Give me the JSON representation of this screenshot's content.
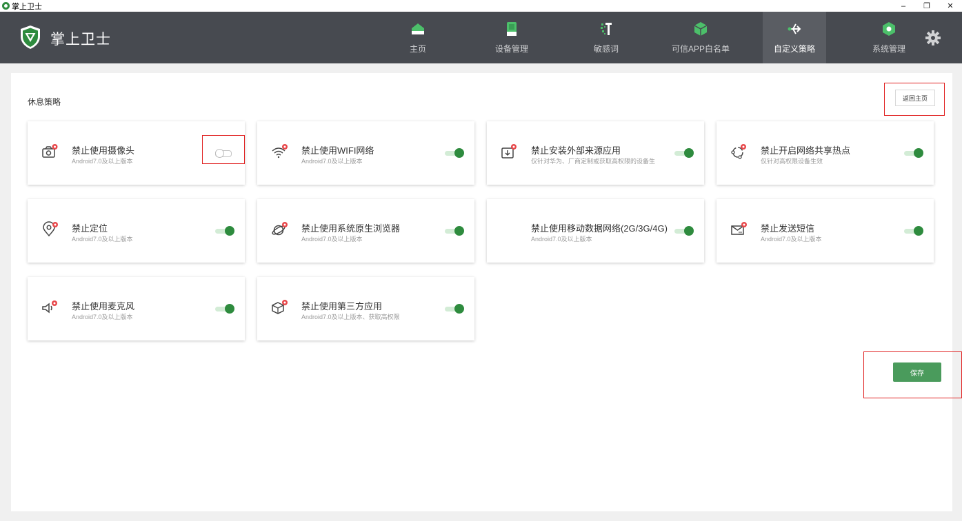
{
  "window": {
    "title": "掌上卫士",
    "buttons": [
      "–",
      "❐",
      "✕"
    ]
  },
  "header": {
    "brand": "掌上卫士",
    "nav": [
      {
        "label": "主页",
        "icon": "home-icon"
      },
      {
        "label": "设备管理",
        "icon": "device-icon"
      },
      {
        "label": "敏感词",
        "icon": "sensitive-word-icon"
      },
      {
        "label": "可信APP白名单",
        "icon": "cube-icon"
      },
      {
        "label": "自定义策略",
        "icon": "share-arrow-icon",
        "active": true
      },
      {
        "label": "系统管理",
        "icon": "settings-hex-icon"
      }
    ],
    "settings_icon": "gear-icon"
  },
  "main": {
    "section_title": "休息策略",
    "back_button": "返回主页",
    "save_button": "保存",
    "cards": [
      {
        "title": "禁止使用摄像头",
        "subtitle": "Android7.0及以上版本",
        "icon": "camera-icon",
        "enabled": false
      },
      {
        "title": "禁止使用WIFI网络",
        "subtitle": "Android7.0及以上版本",
        "icon": "wifi-icon",
        "enabled": true
      },
      {
        "title": "禁止安装外部来源应用",
        "subtitle": "仅针对华为、厂商定制或获取高权限的设备生",
        "icon": "install-icon",
        "enabled": true
      },
      {
        "title": "禁止开启网络共享热点",
        "subtitle": "仅针对高权限设备生效",
        "icon": "hotspot-icon",
        "enabled": true
      },
      {
        "title": "禁止定位",
        "subtitle": "Android7.0及以上版本",
        "icon": "location-icon",
        "enabled": true
      },
      {
        "title": "禁止使用系统原生浏览器",
        "subtitle": "Android7.0及以上版本",
        "icon": "browser-icon",
        "enabled": true
      },
      {
        "title": "禁止使用移动数据网络(2G/3G/4G)",
        "subtitle": "Android7.0及以上版本",
        "icon": "",
        "enabled": true
      },
      {
        "title": "禁止发送短信",
        "subtitle": "Android7.0及以上版本",
        "icon": "sms-icon",
        "enabled": true
      },
      {
        "title": "禁止使用麦克风",
        "subtitle": "Android7.0及以上版本",
        "icon": "microphone-icon",
        "enabled": true
      },
      {
        "title": "禁止使用第三方应用",
        "subtitle": "Android7.0及以上版本、获取高权限",
        "icon": "third-party-app-icon",
        "enabled": true
      }
    ]
  },
  "colors": {
    "header_bg": "#474a50",
    "active_nav_bg": "#5a5d63",
    "accent_green": "#2e8b3e",
    "save_green": "#4a9b5c",
    "badge_red": "#e8474a",
    "highlight_red": "#e02020"
  }
}
